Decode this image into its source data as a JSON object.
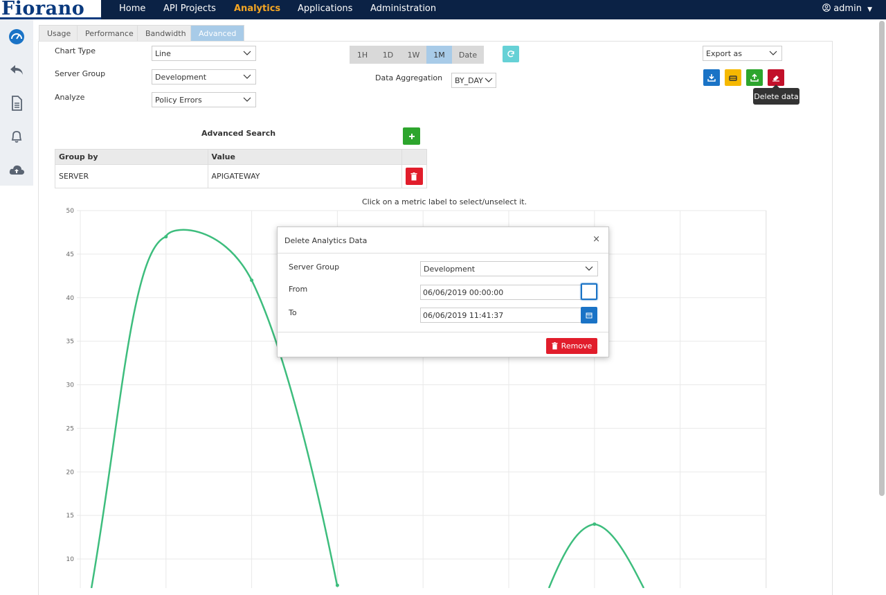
{
  "nav": {
    "logo": "Fiorano",
    "items": [
      "Home",
      "API Projects",
      "Analytics",
      "Applications",
      "Administration"
    ],
    "active": "Analytics",
    "user": "admin"
  },
  "sidebar": {
    "icons": [
      "dashboard-icon",
      "undo-icon",
      "document-icon",
      "bell-icon",
      "cloud-upload-icon"
    ]
  },
  "tabs": [
    "Usage",
    "Performance",
    "Bandwidth",
    "Advanced"
  ],
  "active_tab": "Advanced",
  "form": {
    "chart_type_label": "Chart Type",
    "chart_type_value": "Line",
    "server_group_label": "Server Group",
    "server_group_value": "Development",
    "analyze_label": "Analyze",
    "analyze_value": "Policy Errors",
    "data_aggregation_label": "Data Aggregation",
    "data_aggregation_value": "BY_DAY",
    "export_value": "Export as"
  },
  "time_ranges": [
    "1H",
    "1D",
    "1W",
    "1M",
    "Date"
  ],
  "active_range": "1M",
  "tooltip": "Delete data",
  "advanced_search": {
    "title": "Advanced Search",
    "headers": [
      "Group by",
      "Value"
    ],
    "rows": [
      [
        "SERVER",
        "APIGATEWAY"
      ]
    ]
  },
  "chart_hint": "Click on a metric label to select/unselect it.",
  "chart_data": {
    "type": "line",
    "y_ticks": [
      50,
      45,
      40,
      35,
      30,
      25,
      20,
      15,
      10
    ],
    "ylim": [
      10,
      50
    ],
    "points": [
      {
        "x": 1,
        "y": 47
      },
      {
        "x": 2,
        "y": 42
      },
      {
        "x": 3,
        "y": 6
      },
      {
        "x": 6,
        "y": 14
      }
    ],
    "color": "#3dbd7d"
  },
  "modal": {
    "title": "Delete Analytics Data",
    "server_group_label": "Server Group",
    "server_group_value": "Development",
    "from_label": "From",
    "from_value": "06/06/2019 00:00:00",
    "to_label": "To",
    "to_value": "06/06/2019 11:41:37",
    "remove_label": "Remove",
    "close": "×"
  },
  "colors": {
    "nav_bg": "#0b2245",
    "accent": "#f5a623",
    "danger": "#e11d2b",
    "success": "#2da52d",
    "primary": "#1a73c6"
  }
}
